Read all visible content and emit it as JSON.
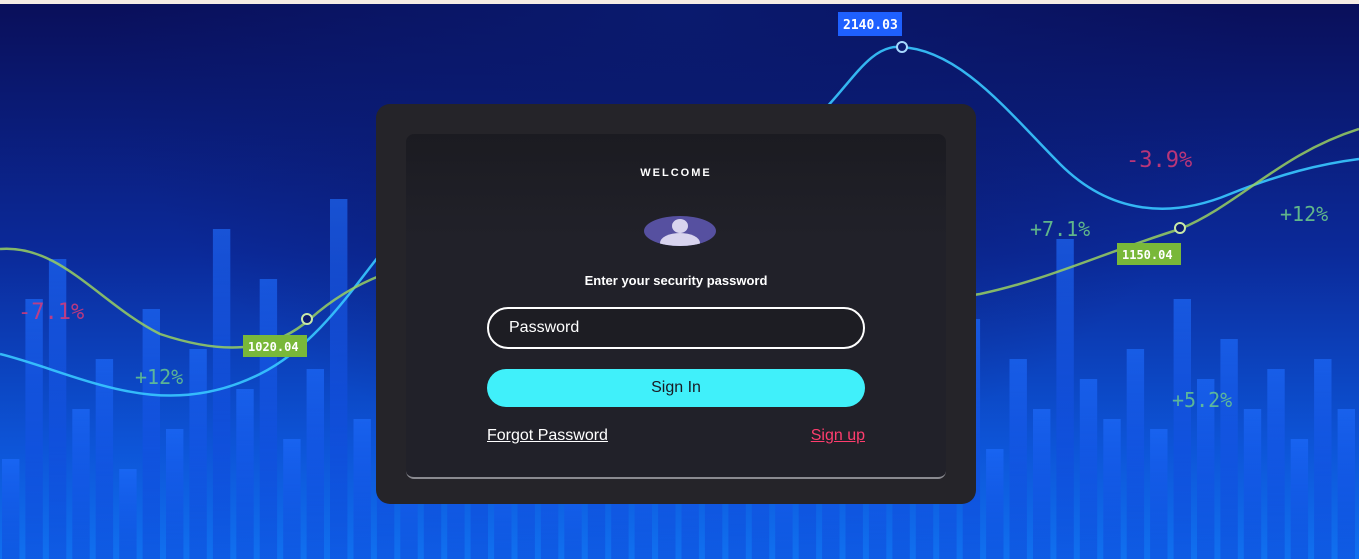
{
  "login": {
    "title": "WELCOME",
    "prompt": "Enter your security password",
    "password_placeholder": "Password",
    "signin_label": "Sign In",
    "forgot_label": "Forgot Password",
    "signup_label": "Sign up"
  },
  "background_labels": {
    "ticker_top": "2140.03",
    "ticker_left": "1020.04",
    "ticker_right": "1150.04",
    "pct_neg_left": "-7.1%",
    "pct_pos_left": "+12%",
    "pct_pos_mid": "+7.1%",
    "pct_neg_right": "-3.9%",
    "pct_pos_right": "+12%",
    "pct_pos_lower_right": "+5.2%"
  },
  "colors": {
    "card_bg": "#252429",
    "signin_accent": "#40f0fa",
    "signup_link": "#ff3d6e"
  }
}
